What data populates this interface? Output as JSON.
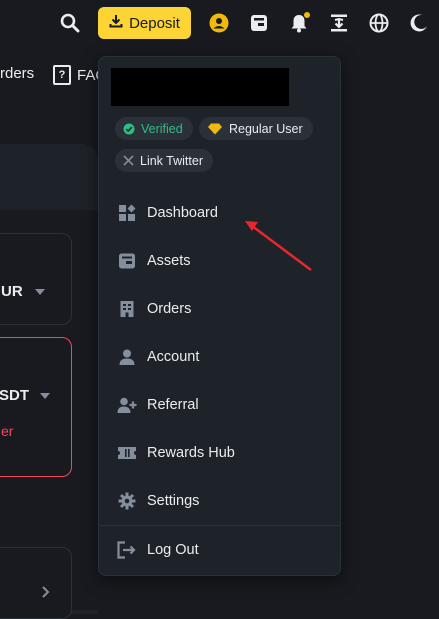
{
  "topbar": {
    "deposit_label": "Deposit",
    "icons": [
      "search-icon",
      "download-icon",
      "user-icon",
      "wallet-icon",
      "bell-icon",
      "transfer-icon",
      "globe-icon",
      "moon-icon"
    ]
  },
  "nav": {
    "orders_label": "rders",
    "faq_label": "FAQ",
    "faq_badge": "?"
  },
  "background": {
    "card1_text": "UR",
    "card2_text": "SDT",
    "card2_sub": "er"
  },
  "dropdown": {
    "verified_label": "Verified",
    "regular_user_label": "Regular User",
    "twitter_label": "Link Twitter",
    "items": [
      {
        "label": "Dashboard",
        "icon": "dashboard-icon"
      },
      {
        "label": "Assets",
        "icon": "wallet-icon"
      },
      {
        "label": "Orders",
        "icon": "orders-icon"
      },
      {
        "label": "Account",
        "icon": "user-icon"
      },
      {
        "label": "Referral",
        "icon": "add-user-icon"
      },
      {
        "label": "Rewards Hub",
        "icon": "ticket-icon"
      },
      {
        "label": "Settings",
        "icon": "gear-icon"
      },
      {
        "label": "Log Out",
        "icon": "logout-icon"
      }
    ]
  },
  "colors": {
    "accent": "#fcd535",
    "success": "#2ebd85",
    "danger": "#f6465d",
    "annotation": "#e8262e"
  }
}
